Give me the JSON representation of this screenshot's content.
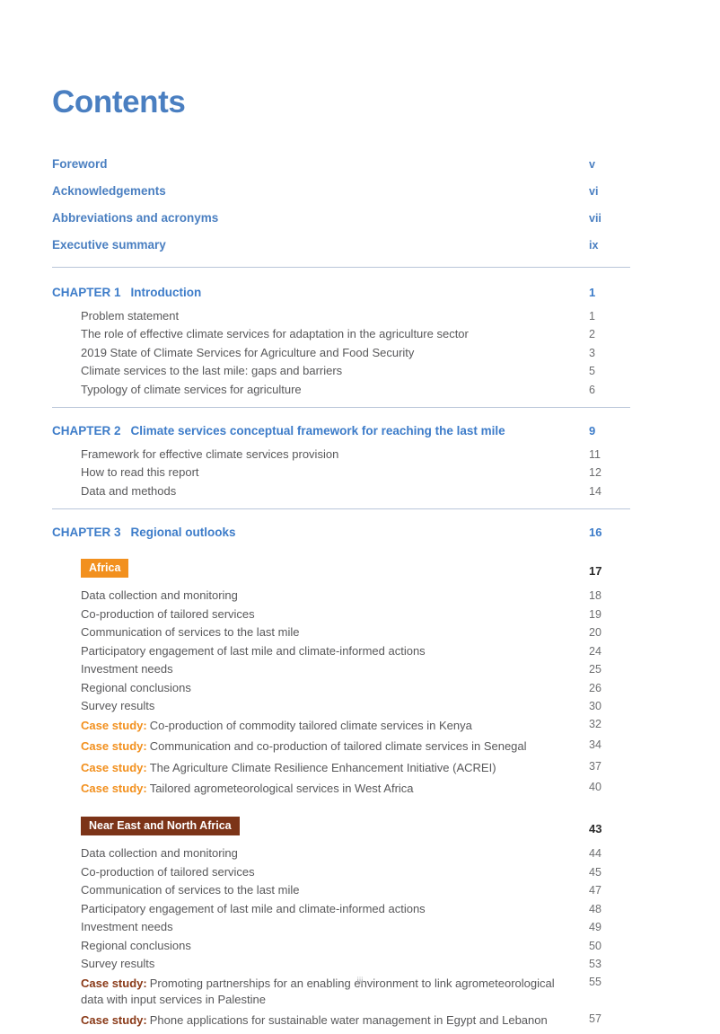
{
  "document": {
    "title": "Contents",
    "footer_page_label": "iii"
  },
  "colors": {
    "heading_blue": "#4a7fc1",
    "chapter_blue": "#3d7cc9",
    "body_gray": "#58585a",
    "africa_orange": "#f2901e",
    "nena_brown": "#7c3418",
    "nena_text_brown": "#8a3a18",
    "divider": "#b9c6d9",
    "footer_gray": "#a7a9ac"
  },
  "front_matter": [
    {
      "label": "Foreword",
      "page": "v"
    },
    {
      "label": "Acknowledgements",
      "page": "vi"
    },
    {
      "label": "Abbreviations and acronyms",
      "page": "vii"
    },
    {
      "label": "Executive summary",
      "page": "ix"
    }
  ],
  "chapters": [
    {
      "number": "CHAPTER 1",
      "title": "Introduction",
      "page": "1",
      "entries": [
        {
          "label": "Problem statement",
          "page": "1"
        },
        {
          "label": "The role of effective climate services for adaptation in the agriculture sector",
          "page": "2"
        },
        {
          "label": "2019 State of Climate Services for Agriculture and Food Security",
          "page": "3"
        },
        {
          "label": "Climate services to the last mile: gaps and barriers",
          "page": "5"
        },
        {
          "label": "Typology of climate services for agriculture",
          "page": "6"
        }
      ]
    },
    {
      "number": "CHAPTER 2",
      "title": "Climate services conceptual framework for reaching the last mile",
      "page": "9",
      "entries": [
        {
          "label": "Framework for effective climate services provision",
          "page": "11"
        },
        {
          "label": "How to read this report",
          "page": "12"
        },
        {
          "label": "Data and methods",
          "page": "14"
        }
      ]
    },
    {
      "number": "CHAPTER 3",
      "title": "Regional outlooks",
      "page": "16",
      "entries": []
    }
  ],
  "regions": [
    {
      "badge_label": "Africa",
      "badge_color": "#f2901e",
      "page": "17",
      "entries": [
        {
          "label": "Data collection and monitoring",
          "page": "18"
        },
        {
          "label": "Co-production of tailored services",
          "page": "19"
        },
        {
          "label": "Communication of services to the last mile",
          "page": "20"
        },
        {
          "label": "Participatory engagement of last mile and climate-informed actions",
          "page": "24"
        },
        {
          "label": "Investment needs",
          "page": "25"
        },
        {
          "label": "Regional conclusions",
          "page": "26"
        },
        {
          "label": "Survey results",
          "page": "30"
        }
      ],
      "case_studies": [
        {
          "tag": "Case study:",
          "text": "Co-production of commodity tailored climate services in Kenya",
          "page": "32"
        },
        {
          "tag": "Case study:",
          "text": "Communication and co-production of tailored climate services in Senegal",
          "page": "34"
        },
        {
          "tag": "Case study:",
          "text": "The Agriculture Climate Resilience Enhancement Initiative (ACREI)",
          "page": "37"
        },
        {
          "tag": "Case study:",
          "text": "Tailored agrometeorological services in West Africa",
          "page": "40"
        }
      ]
    },
    {
      "badge_label": "Near East and North Africa",
      "badge_color": "#7c3418",
      "page": "43",
      "entries": [
        {
          "label": "Data collection and monitoring",
          "page": "44"
        },
        {
          "label": "Co-production of tailored services",
          "page": "45"
        },
        {
          "label": "Communication of services to the last mile",
          "page": "47"
        },
        {
          "label": "Participatory engagement of last mile and climate-informed actions",
          "page": "48"
        },
        {
          "label": "Investment needs",
          "page": "49"
        },
        {
          "label": "Regional conclusions",
          "page": "50"
        },
        {
          "label": "Survey results",
          "page": "53"
        }
      ],
      "case_studies": [
        {
          "tag": "Case study:",
          "text": "Promoting partnerships for an enabling environment to link agrometeorological data with input services in Palestine",
          "page": "55"
        },
        {
          "tag": "Case study:",
          "text": "Phone applications for sustainable water management in Egypt and Lebanon",
          "page": "57"
        }
      ]
    }
  ]
}
